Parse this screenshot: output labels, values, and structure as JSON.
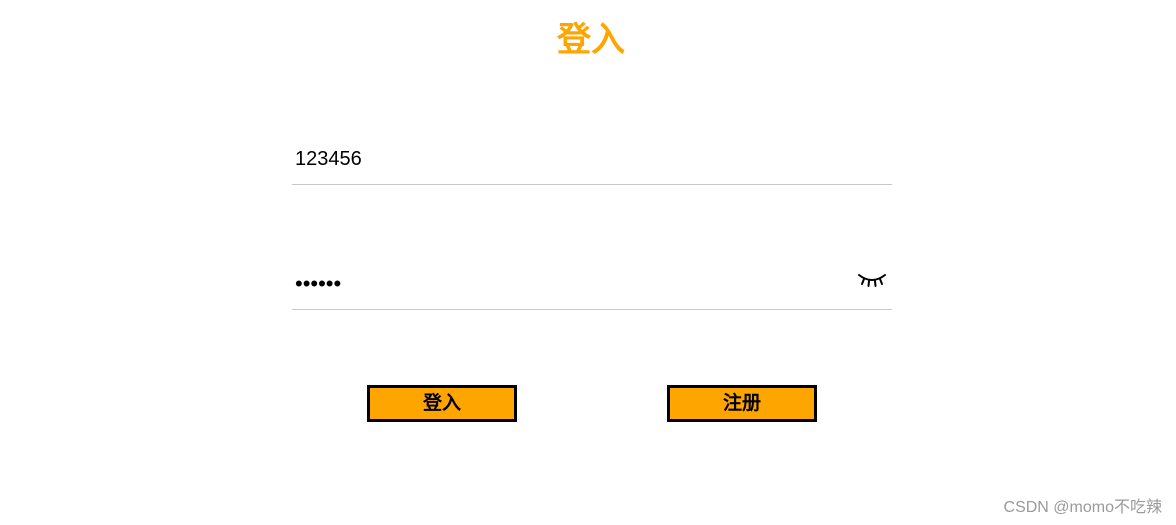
{
  "header": {
    "title": "登入"
  },
  "form": {
    "username": {
      "value": "123456"
    },
    "password": {
      "value": "123456",
      "toggle_icon": "eye-closed-icon"
    },
    "buttons": {
      "login_label": "登入",
      "register_label": "注册"
    }
  },
  "watermark": {
    "text": "CSDN @momo不吃辣"
  },
  "colors": {
    "accent": "#ffa500",
    "button_border": "#000000",
    "underline": "#c8c8c8",
    "watermark": "#9a9a9a"
  }
}
